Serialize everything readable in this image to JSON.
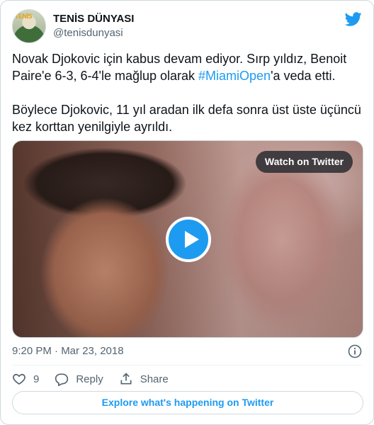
{
  "author": {
    "name": "TENİS DÜNYASI",
    "handle": "@tenisdunyasi",
    "avatar_text": "TENİS"
  },
  "tweet": {
    "line1_pre": "Novak Djokovic için kabus devam ediyor. Sırp yıldız, Benoit Paire'e 6-3, 6-4'le mağlup olarak ",
    "hashtag": "#MiamiOpen",
    "line1_post": "'a veda etti.",
    "paragraph2": "Böylece Djokovic, 11 yıl aradan ilk defa sonra üst üste üçüncü kez korttan yenilgiyle ayrıldı."
  },
  "media": {
    "watch_label": "Watch on Twitter"
  },
  "timestamp": "9:20 PM · Mar 23, 2018",
  "actions": {
    "likes": "9",
    "reply_label": "Reply",
    "share_label": "Share"
  },
  "explore_label": "Explore what's happening on Twitter",
  "colors": {
    "accent": "#1d9bf0",
    "text": "#0f1419",
    "secondary": "#536471",
    "border": "#cfd9de"
  }
}
